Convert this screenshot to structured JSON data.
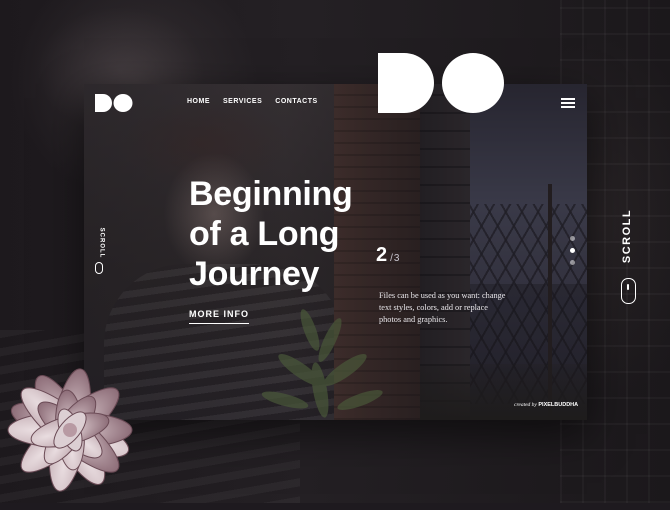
{
  "brand": {
    "logo_text": "DO"
  },
  "nav": {
    "items": [
      {
        "label": "HOME"
      },
      {
        "label": "SERVICES"
      },
      {
        "label": "CONTACTS"
      }
    ]
  },
  "hero": {
    "title": "Beginning\nof a Long\nJourney",
    "cta_label": "MORE INFO"
  },
  "slider": {
    "current": "2",
    "separator": "/",
    "total": "3",
    "description": "Files can be used as you want: change text styles, colors, add or replace photos and graphics.",
    "dots": 3,
    "active_dot": 1
  },
  "scroll_label": "SCROLL",
  "credit": {
    "prefix": "created by",
    "author": "PIXELBUDDHA"
  },
  "colors": {
    "background": "#1e1a1f",
    "text": "#ffffff"
  }
}
